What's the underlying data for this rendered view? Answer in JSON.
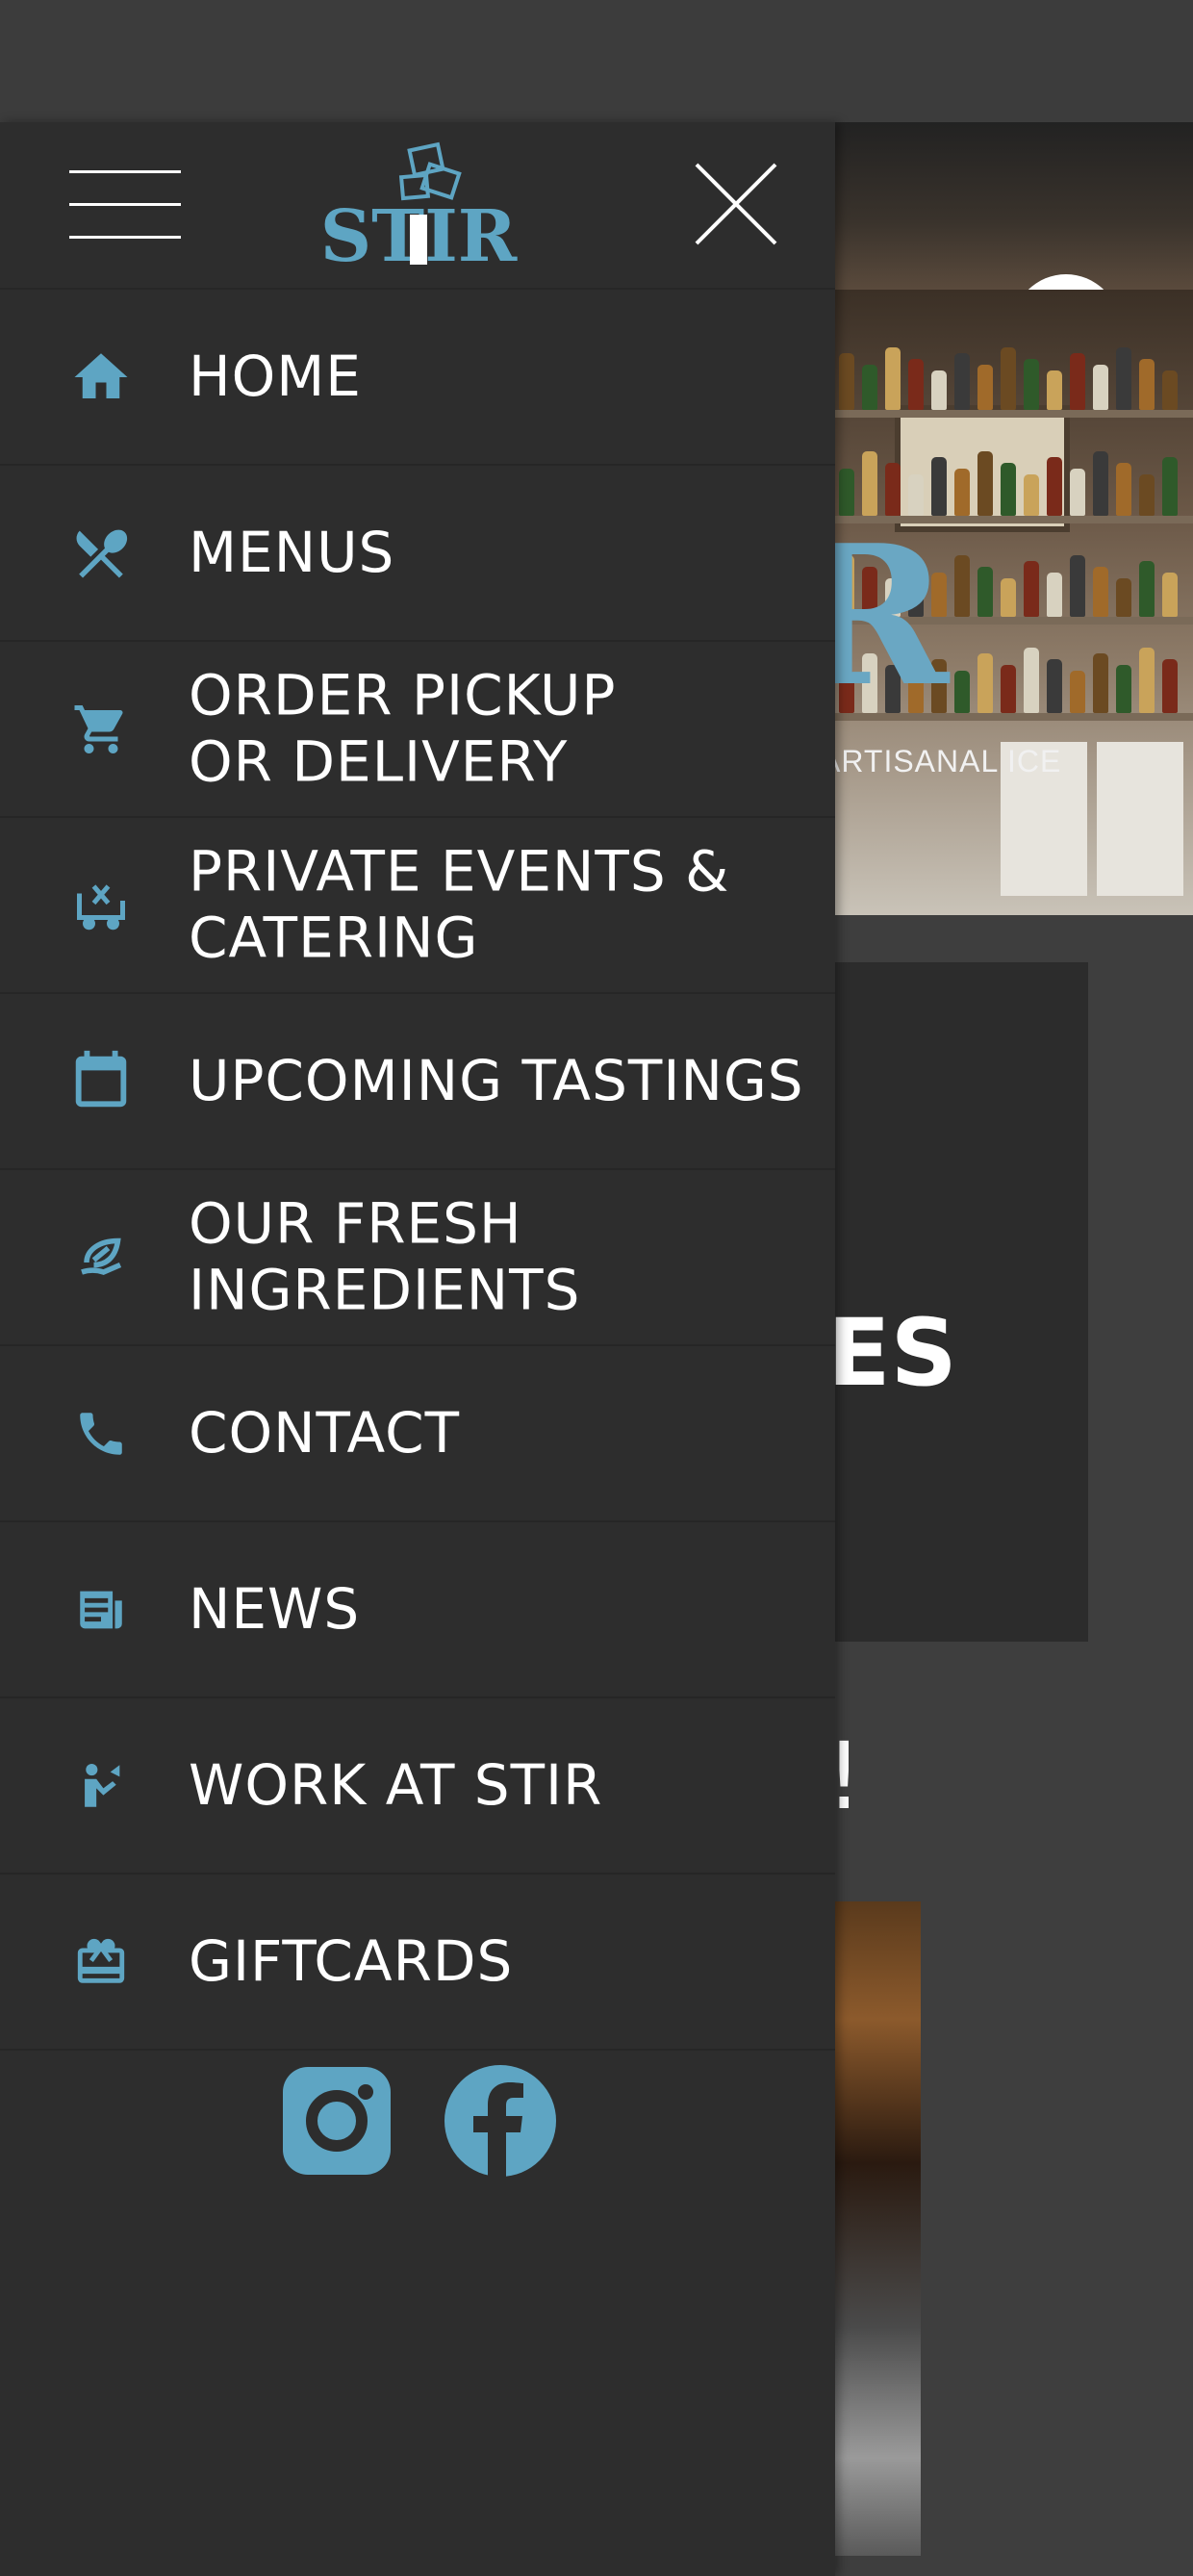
{
  "colors": {
    "accent": "#5ea5c3",
    "drawer_bg": "#2d2d2d",
    "page_bg": "#3e3e3e",
    "text": "#ffffff"
  },
  "drawer": {
    "logo_text": "STIR",
    "menu_icon": "hamburger-icon",
    "close_icon": "close-icon",
    "nav_items": [
      {
        "label": "HOME",
        "icon": "home-icon"
      },
      {
        "label": "MENUS",
        "icon": "fork-spoon-icon"
      },
      {
        "label": "ORDER PICKUP\nOR DELIVERY",
        "icon": "cart-icon"
      },
      {
        "label": "PRIVATE EVENTS &\nCATERING",
        "icon": "catering-cart-icon"
      },
      {
        "label": "UPCOMING TASTINGS",
        "icon": "calendar-icon"
      },
      {
        "label": "OUR FRESH\nINGREDIENTS",
        "icon": "leaf-hand-icon"
      },
      {
        "label": "CONTACT",
        "icon": "phone-icon"
      },
      {
        "label": "NEWS",
        "icon": "newspaper-icon"
      },
      {
        "label": "WORK AT STIR",
        "icon": "career-icon"
      },
      {
        "label": "GIFTCARDS",
        "icon": "giftcard-icon"
      }
    ],
    "social": [
      {
        "name": "Instagram",
        "icon": "instagram-icon"
      },
      {
        "name": "Facebook",
        "icon": "facebook-icon"
      }
    ]
  },
  "page": {
    "account_icon": "account-icon",
    "hero_tagline": "S - ARTISANAL ICE",
    "hero_partial_letter": "R",
    "card_heading_partial": "ES",
    "section_heading_partial": "!"
  }
}
